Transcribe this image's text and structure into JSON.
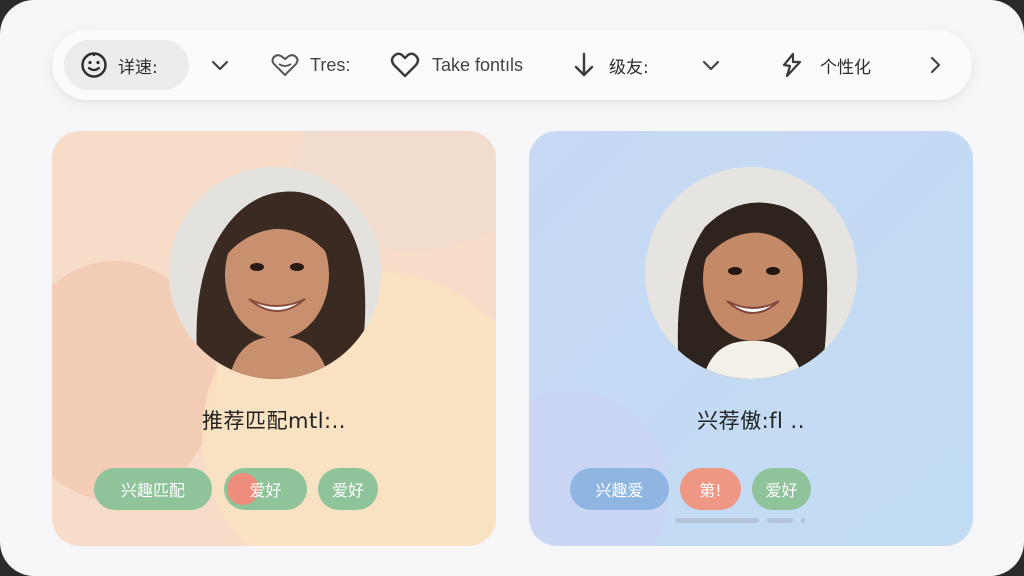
{
  "toolbar": {
    "items": [
      {
        "label": "详速:",
        "icon": "smiley-icon"
      },
      {
        "label": "",
        "icon": "chevron-down-icon"
      },
      {
        "label": "Tres:",
        "icon": "heart-outline-icon"
      },
      {
        "label": "Take fontıls",
        "icon": "heart-icon"
      },
      {
        "label": "级友:",
        "icon": "arrow-down-icon"
      },
      {
        "label": "",
        "icon": "chevron-down-icon"
      },
      {
        "label": "个性化",
        "icon": "sparkle-icon"
      },
      {
        "label": "",
        "icon": "chevron-right-icon"
      }
    ]
  },
  "cards": [
    {
      "title": "推荐匹配mtl:..",
      "theme": "peach",
      "tags": [
        {
          "label": "兴趣匹配",
          "color": "#8fc39a"
        },
        {
          "label": "爱好",
          "color": "#8fc39a"
        },
        {
          "label": "爱好",
          "color": "#8fc39a"
        }
      ]
    },
    {
      "title": "兴荐傲:fl ..",
      "theme": "blue",
      "tags": [
        {
          "label": "兴趣爱",
          "color": "#8fb6e3"
        },
        {
          "label": "第!",
          "color": "#ee9785"
        },
        {
          "label": "爱好",
          "color": "#8fc39a"
        }
      ]
    }
  ],
  "colors": {
    "background": "#f6f6f8",
    "card_left": "#f6dcc9",
    "card_right": "#c7d9f4",
    "tag_green": "#8fc39a",
    "tag_blue": "#8fb6e3",
    "tag_orange": "#ee9785"
  }
}
